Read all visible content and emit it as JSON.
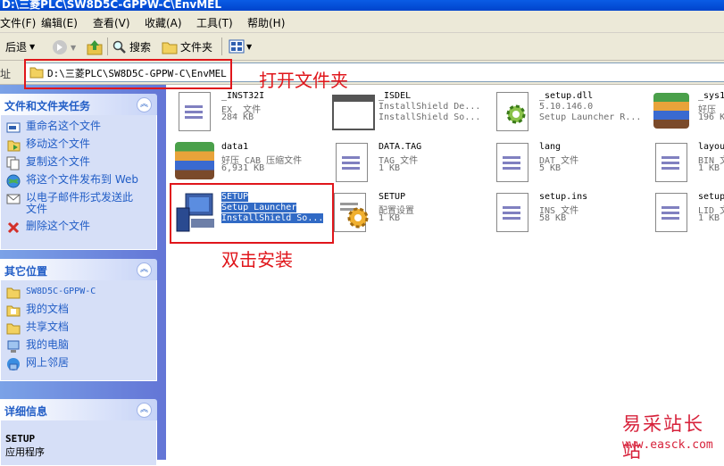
{
  "window": {
    "title": "D:\\三菱PLC\\SW8D5C-GPPW-C\\EnvMEL"
  },
  "menu": [
    {
      "label": "文件(F)"
    },
    {
      "label": "编辑(E)"
    },
    {
      "label": "查看(V)"
    },
    {
      "label": "收藏(A)"
    },
    {
      "label": "工具(T)"
    },
    {
      "label": "帮助(H)"
    }
  ],
  "toolbar": {
    "back_label": "后退",
    "search_label": "搜索",
    "folders_label": "文件夹"
  },
  "address": {
    "label": "址",
    "value": "D:\\三菱PLC\\SW8D5C-GPPW-C\\EnvMEL"
  },
  "tasks_panel": {
    "title": "文件和文件夹任务",
    "items": [
      {
        "label": "重命名这个文件",
        "icon": "rename-icon"
      },
      {
        "label": "移动这个文件",
        "icon": "move-icon"
      },
      {
        "label": "复制这个文件",
        "icon": "copy-icon"
      },
      {
        "label": "将这个文件发布到 Web",
        "icon": "web-publish-icon"
      },
      {
        "label": "以电子邮件形式发送此文件",
        "icon": "email-icon"
      },
      {
        "label": "删除这个文件",
        "icon": "delete-icon"
      }
    ]
  },
  "places_panel": {
    "title": "其它位置",
    "items": [
      {
        "label": "SW8D5C-GPPW-C",
        "icon": "folder-icon"
      },
      {
        "label": "我的文档",
        "icon": "my-documents-icon"
      },
      {
        "label": "共享文档",
        "icon": "shared-documents-icon"
      },
      {
        "label": "我的电脑",
        "icon": "my-computer-icon"
      },
      {
        "label": "网上邻居",
        "icon": "network-icon"
      }
    ]
  },
  "details_panel": {
    "title": "详细信息",
    "name": "SETUP",
    "type": "应用程序"
  },
  "files": [
    {
      "name": "_INST32I",
      "type": "EX_ 文件",
      "size": "284 KB",
      "icon": "document-icon"
    },
    {
      "name": "_ISDEL",
      "type": "InstallShield De...",
      "size": "InstallShield So...",
      "icon": "window-app-icon"
    },
    {
      "name": "_setup.dll",
      "type": "5.10.146.0",
      "size": "Setup Launcher R...",
      "icon": "dll-icon"
    },
    {
      "name": "_sys1",
      "type": "好压",
      "size": "196 K",
      "icon": "archive-icon"
    },
    {
      "name": "data1",
      "type": "好压 CAB 压缩文件",
      "size": "6,931 KB",
      "icon": "archive-icon"
    },
    {
      "name": "DATA.TAG",
      "type": "TAG 文件",
      "size": "1 KB",
      "icon": "document-icon"
    },
    {
      "name": "lang",
      "type": "DAT 文件",
      "size": "5 KB",
      "icon": "document-icon"
    },
    {
      "name": "layou",
      "type": "BIN 文",
      "size": "1 KB",
      "icon": "document-icon"
    },
    {
      "name": "SETUP",
      "type": "Setup Launcher",
      "size": "InstallShield So...",
      "icon": "setup-computer-icon",
      "selected": true
    },
    {
      "name": "SETUP",
      "type": "配置设置",
      "size": "1 KB",
      "icon": "settings-file-icon"
    },
    {
      "name": "setup.ins",
      "type": "INS 文件",
      "size": "58 KB",
      "icon": "document-icon"
    },
    {
      "name": "setup",
      "type": "LID 文",
      "size": "1 KB",
      "icon": "document-icon"
    }
  ],
  "annotations": {
    "open_folder": "打开文件夹",
    "double_click": "双击安装"
  },
  "watermark": {
    "line1": "易采站长站",
    "line2": "www.easck.com"
  },
  "colors": {
    "accent": "#316ac5",
    "annotation_red": "#e0161b",
    "task_link": "#215dc6"
  }
}
